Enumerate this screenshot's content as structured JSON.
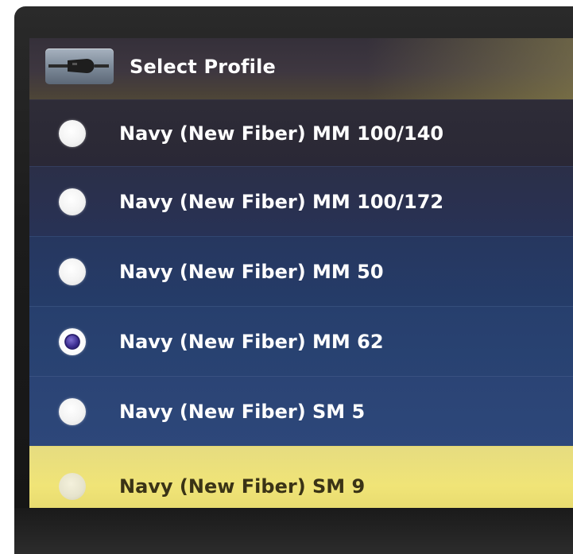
{
  "header": {
    "title": "Select Profile",
    "icon": "fiber-connector-icon"
  },
  "profiles": [
    {
      "label": "Navy (New Fiber) MM 100/140",
      "selected": false
    },
    {
      "label": "Navy (New Fiber) MM 100/172",
      "selected": false
    },
    {
      "label": "Navy (New Fiber) MM 50",
      "selected": false
    },
    {
      "label": "Navy (New Fiber) MM 62",
      "selected": true
    },
    {
      "label": "Navy (New Fiber) SM 5",
      "selected": false
    },
    {
      "label": "Navy (New Fiber) SM 9",
      "selected": false,
      "highlighted": true
    }
  ],
  "colors": {
    "highlight": "#f0e477",
    "selected_radio": "#3d2e92"
  }
}
